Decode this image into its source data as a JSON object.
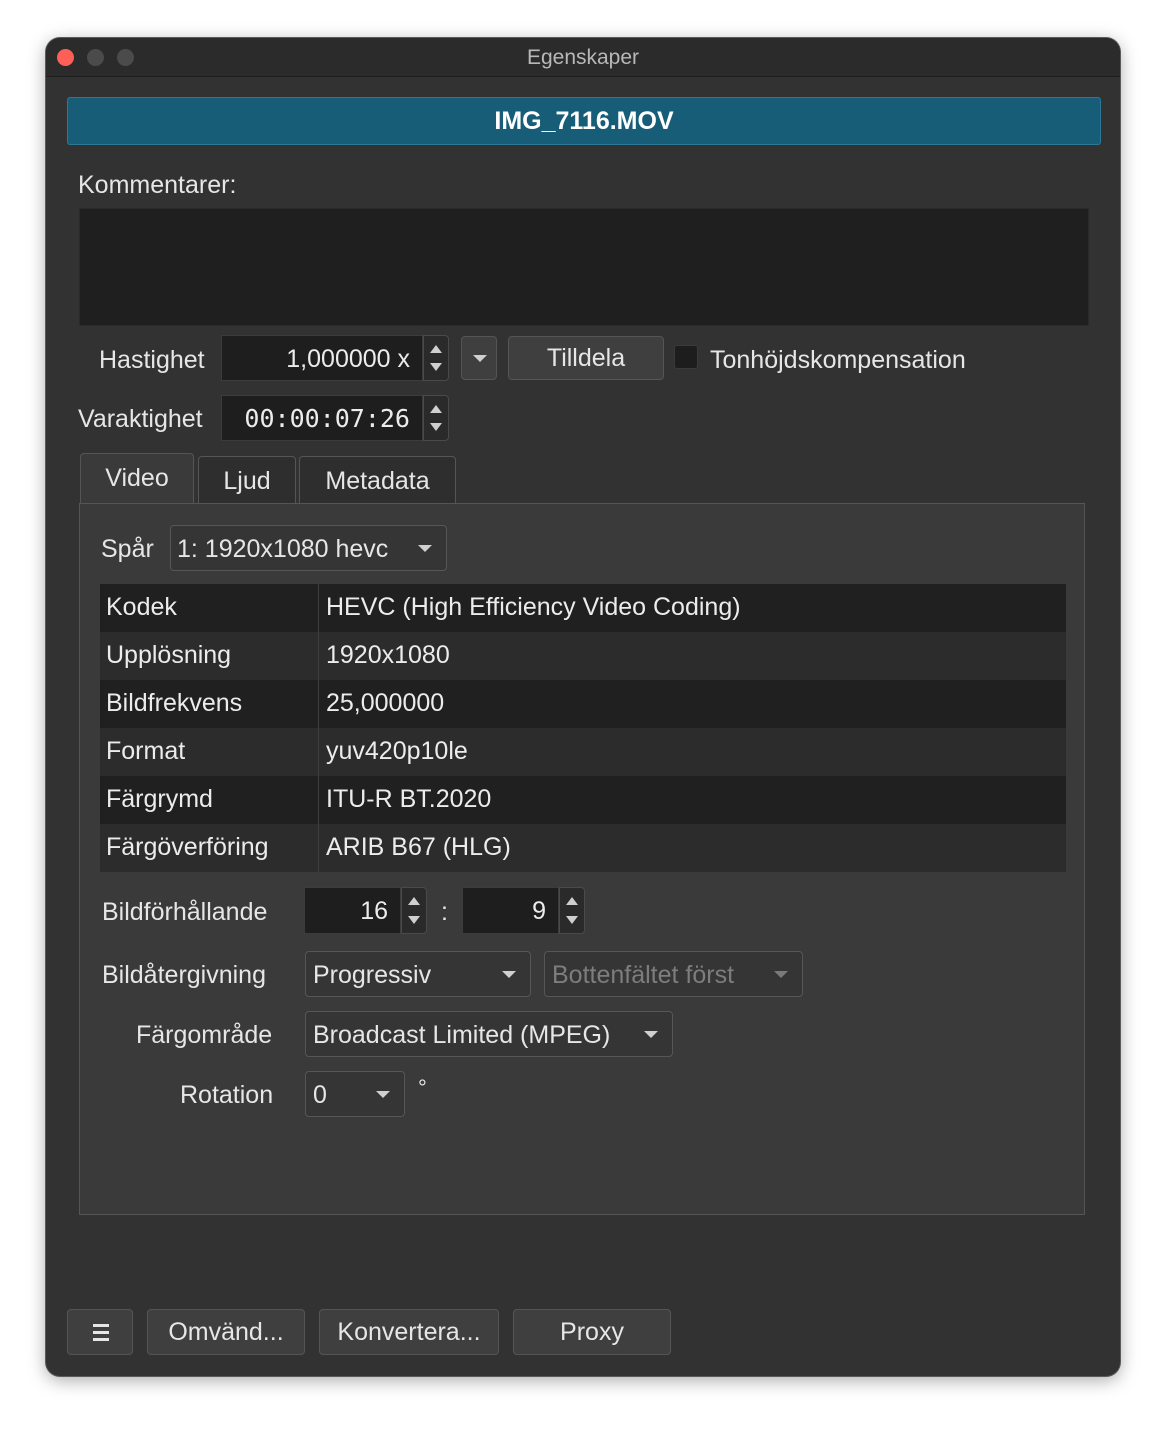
{
  "window": {
    "title": "Egenskaper"
  },
  "file": {
    "name": "IMG_7116.MOV"
  },
  "comments": {
    "label": "Kommentarer:",
    "value": ""
  },
  "speed": {
    "label": "Hastighet",
    "value": "1,000000 x",
    "apply_label": "Tilldela",
    "pitch_label": "Tonhöjdskompensation",
    "pitch_checked": false
  },
  "duration": {
    "label": "Varaktighet",
    "value": "00:00:07:26"
  },
  "tabs": [
    {
      "label": "Video",
      "active": true
    },
    {
      "label": "Ljud",
      "active": false
    },
    {
      "label": "Metadata",
      "active": false
    }
  ],
  "track": {
    "label": "Spår",
    "selected": "1: 1920x1080 hevc"
  },
  "properties": [
    {
      "key": "Kodek",
      "value": "HEVC (High Efficiency Video Coding)"
    },
    {
      "key": "Upplösning",
      "value": "1920x1080"
    },
    {
      "key": "Bildfrekvens",
      "value": "25,000000"
    },
    {
      "key": "Format",
      "value": "yuv420p10le"
    },
    {
      "key": "Färgrymd",
      "value": "ITU-R BT.2020"
    },
    {
      "key": "Färgöverföring",
      "value": "ARIB B67 (HLG)"
    }
  ],
  "aspect": {
    "label": "Bildförhållande",
    "width": "16",
    "separator": ":",
    "height": "9"
  },
  "scan": {
    "label": "Bildåtergivning",
    "mode": "Progressiv",
    "field_order": "Bottenfältet först"
  },
  "color_range": {
    "label": "Färgområde",
    "value": "Broadcast Limited (MPEG)"
  },
  "rotation": {
    "label": "Rotation",
    "value": "0",
    "unit": "°"
  },
  "footer": {
    "reverse_label": "Omvänd...",
    "convert_label": "Konvertera...",
    "proxy_label": "Proxy"
  },
  "colors": {
    "accent": "#175d78",
    "window_bg": "#323232",
    "close_button": "#fe5f57"
  }
}
